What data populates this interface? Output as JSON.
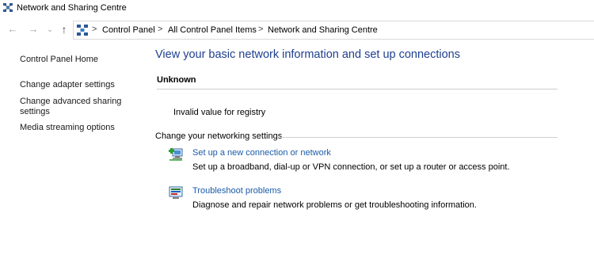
{
  "window": {
    "title": "Network and Sharing Centre"
  },
  "address_bar": {
    "breadcrumbs": [
      "Control Panel",
      "All Control Panel Items",
      "Network and Sharing Centre"
    ],
    "separator": ">"
  },
  "nav_glyphs": {
    "back": "←",
    "forward": "→",
    "recent": "⌄",
    "up": "↑"
  },
  "sidebar": {
    "items": [
      {
        "label": "Control Panel Home"
      },
      {
        "label": "Change adapter settings"
      },
      {
        "label": "Change advanced sharing"
      },
      {
        "label": "settings"
      },
      {
        "label": "Media streaming options"
      }
    ]
  },
  "main": {
    "heading": "View your basic network information and set up connections",
    "network_name": "Unknown",
    "registry_message": "Invalid value for registry",
    "section_title": "Change your networking settings",
    "tasks": [
      {
        "icon": "new-connection-icon",
        "link": "Set up a new connection or network",
        "description": "Set up a broadband, dial-up or VPN connection, or set up a router or access point."
      },
      {
        "icon": "troubleshoot-icon",
        "link": "Troubleshoot problems",
        "description": "Diagnose and repair network problems or get troubleshooting information."
      }
    ]
  },
  "colors": {
    "heading": "#1e3f8f",
    "link": "#1a5ba8",
    "rule": "#cfcfcf"
  }
}
